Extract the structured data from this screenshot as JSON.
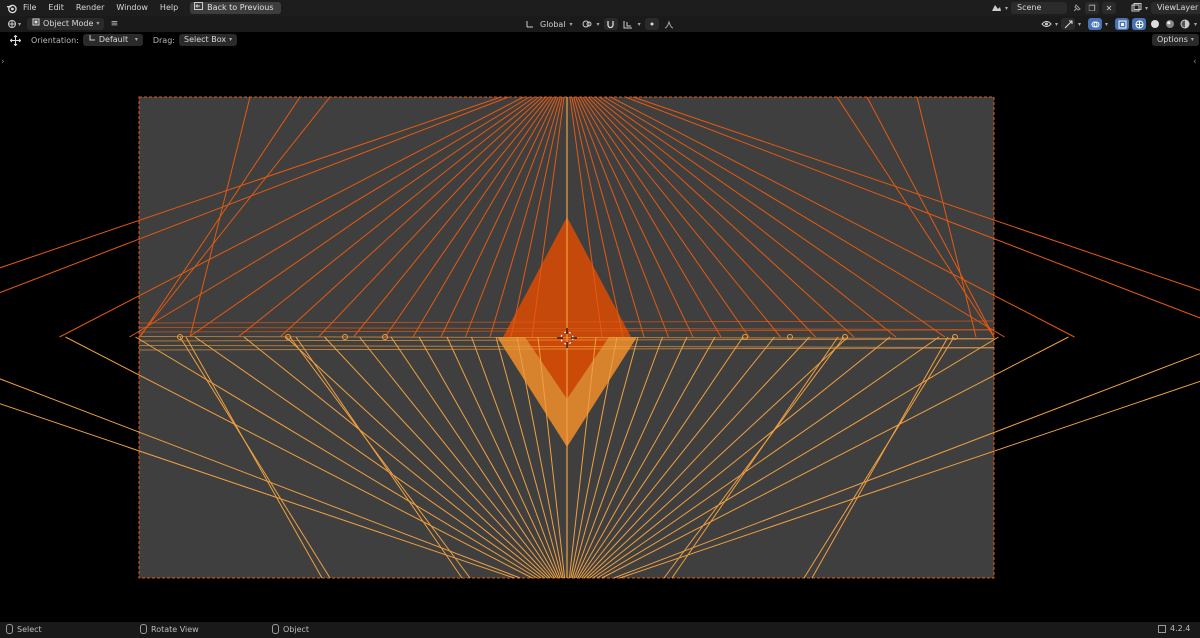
{
  "menu": {
    "items": [
      "File",
      "Edit",
      "Render",
      "Window",
      "Help"
    ],
    "back_button": "Back to Previous"
  },
  "topright": {
    "scene": "Scene",
    "view_layer": "ViewLayer"
  },
  "viewport_header": {
    "mode": "Object Mode",
    "transform_orientation": "Global"
  },
  "tool_settings": {
    "orientation_label": "Orientation:",
    "orientation_value": "Default",
    "drag_label": "Drag:",
    "drag_value": "Select Box",
    "options_label": "Options"
  },
  "status_bar": {
    "select": "Select",
    "rotate_view": "Rotate View",
    "object": "Object",
    "version": "4.2.4"
  },
  "colors": {
    "viewport_bg": "#000000",
    "plane_fill": "#3f3f3f",
    "wire_dark": "#e55a10",
    "wire_light": "#f0a040",
    "fill_dark": "#cc4a08",
    "fill_light": "#e8892a",
    "accent_blue": "#4772b3"
  }
}
